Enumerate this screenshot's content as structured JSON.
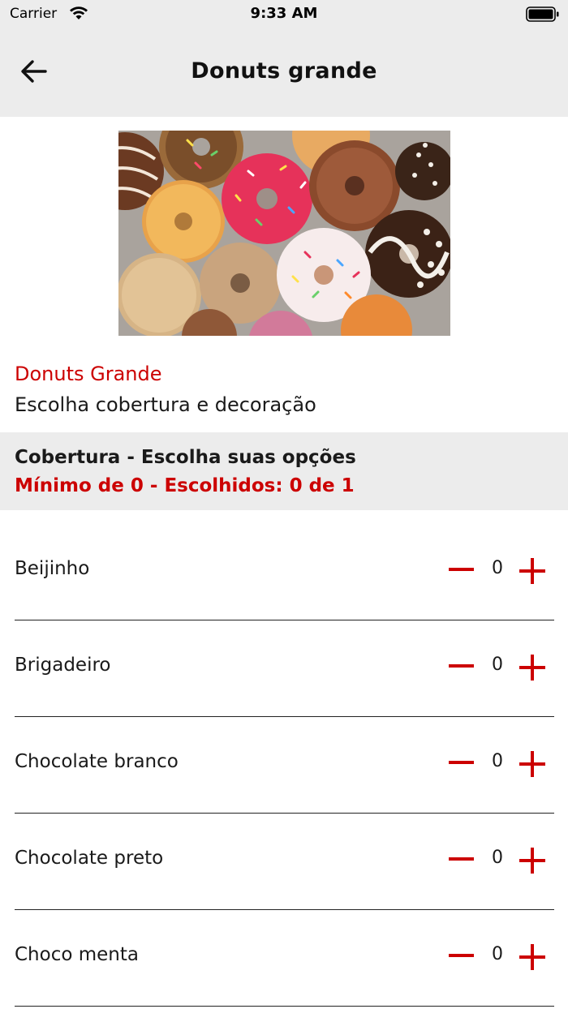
{
  "status_bar": {
    "carrier": "Carrier",
    "time": "9:33 AM"
  },
  "header": {
    "title": "Donuts grande",
    "back_icon": "arrow-left-icon"
  },
  "hero_image": {
    "subject": "assorted donuts"
  },
  "product": {
    "name": "Donuts Grande",
    "description": "Escolha cobertura e decoração"
  },
  "group": {
    "title": "Cobertura - Escolha suas opções",
    "rule": "Mínimo de 0 - Escolhidos: 0 de 1"
  },
  "options": [
    {
      "label": "Beijinho",
      "qty": "0"
    },
    {
      "label": "Brigadeiro",
      "qty": "0"
    },
    {
      "label": "Chocolate branco",
      "qty": "0"
    },
    {
      "label": "Chocolate preto",
      "qty": "0"
    },
    {
      "label": "Choco menta",
      "qty": "0"
    }
  ],
  "colors": {
    "accent": "#cc0000",
    "header_bg": "#ececec",
    "text": "#1a1a1a"
  }
}
